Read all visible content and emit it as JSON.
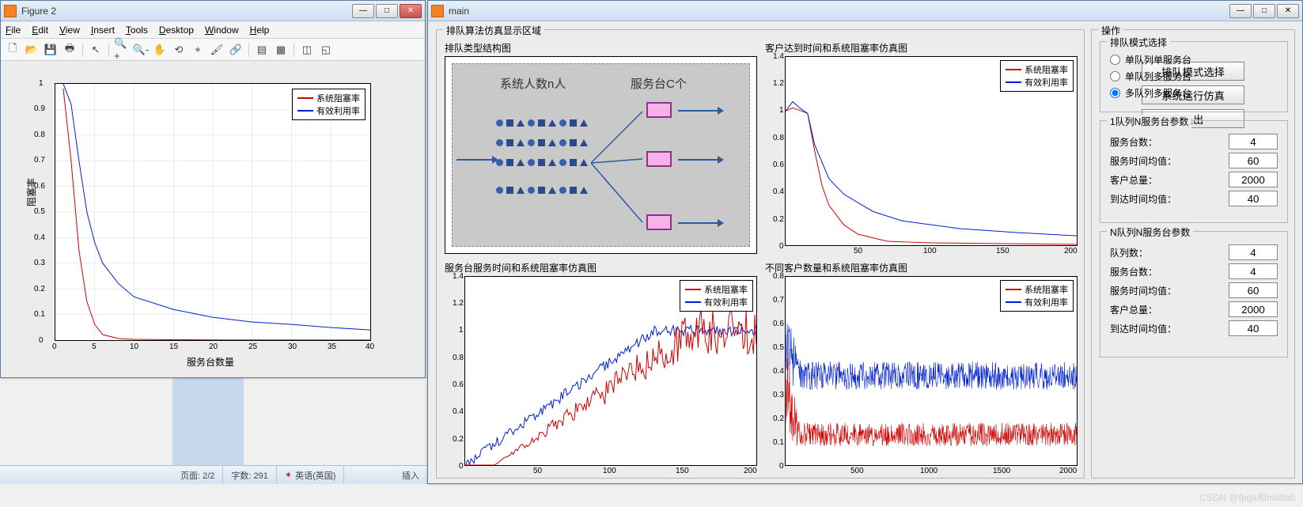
{
  "figure_window": {
    "title": "Figure 2",
    "menus": [
      "File",
      "Edit",
      "View",
      "Insert",
      "Tools",
      "Desktop",
      "Window",
      "Help"
    ],
    "toolbar_icons": [
      "new-file",
      "open",
      "save",
      "print",
      "pointer",
      "zoom-in",
      "zoom-out",
      "pan",
      "rotate",
      "data-cursor",
      "brush",
      "link",
      "colorbar",
      "legend",
      "sep",
      "dock",
      "undock"
    ]
  },
  "main_window": {
    "title": "main"
  },
  "status": {
    "page": "页面: 2/2",
    "chars": "字数: 291",
    "lang": "英语(英国)",
    "insert": "插入"
  },
  "watermark": "CSDN @fpga和matlab",
  "sim_area_title": "排队算法仿真显示区域",
  "ops_title": "操作",
  "panels": {
    "p1": {
      "title": "排队类型结构图",
      "text_people": "系统人数n人",
      "text_servers": "服务台C个"
    },
    "p2": {
      "title": "客户达到时间和系统阻塞率仿真图"
    },
    "p3": {
      "title": "服务台服务时间和系统阻塞率仿真图"
    },
    "p4": {
      "title": "不同客户数量和系统阻塞率仿真图"
    }
  },
  "legend": {
    "red": "系统阻塞率",
    "blue": "有效利用率"
  },
  "fig_chart": {
    "xlabel": "服务台数量",
    "ylabel": "阻塞率",
    "xticks": [
      "0",
      "5",
      "10",
      "15",
      "20",
      "25",
      "30",
      "35",
      "40"
    ],
    "yticks": [
      "0",
      "0.1",
      "0.2",
      "0.3",
      "0.4",
      "0.5",
      "0.6",
      "0.7",
      "0.8",
      "0.9",
      "1"
    ]
  },
  "chart_data": [
    {
      "type": "line",
      "title": "Figure 2",
      "xlabel": "服务台数量",
      "ylabel": "阻塞率",
      "xlim": [
        0,
        40
      ],
      "ylim": [
        0,
        1
      ],
      "series": [
        {
          "name": "系统阻塞率",
          "color": "#d00000",
          "x": [
            1,
            2,
            3,
            4,
            5,
            6,
            8,
            10,
            15,
            20,
            25,
            30,
            35,
            40
          ],
          "y": [
            0.98,
            0.7,
            0.35,
            0.15,
            0.06,
            0.02,
            0.005,
            0.002,
            0.001,
            0.0005,
            0.0003,
            0.0002,
            0.0001,
            0.0001
          ]
        },
        {
          "name": "有效利用率",
          "color": "#0020d0",
          "x": [
            1,
            2,
            3,
            4,
            5,
            6,
            8,
            10,
            15,
            20,
            25,
            30,
            35,
            40
          ],
          "y": [
            1.0,
            0.92,
            0.7,
            0.5,
            0.38,
            0.3,
            0.22,
            0.17,
            0.12,
            0.09,
            0.07,
            0.06,
            0.05,
            0.04
          ]
        }
      ]
    },
    {
      "type": "line",
      "title": "客户达到时间和系统阻塞率仿真图",
      "xlim": [
        0,
        200
      ],
      "ylim": [
        0,
        1.4
      ],
      "xticks": [
        0,
        50,
        100,
        150,
        200
      ],
      "yticks": [
        0,
        0.2,
        0.4,
        0.6,
        0.8,
        1.0,
        1.2,
        1.4
      ],
      "series": [
        {
          "name": "系统阻塞率",
          "color": "#d00000",
          "x": [
            0,
            5,
            10,
            15,
            20,
            25,
            30,
            40,
            50,
            70,
            100,
            150,
            200
          ],
          "y": [
            1.0,
            1.02,
            0.98,
            0.9,
            0.7,
            0.45,
            0.3,
            0.15,
            0.08,
            0.03,
            0.015,
            0.008,
            0.005
          ]
        },
        {
          "name": "有效利用率",
          "color": "#0020d0",
          "x": [
            0,
            5,
            10,
            15,
            20,
            30,
            40,
            60,
            80,
            120,
            160,
            200
          ],
          "y": [
            1.0,
            1.07,
            1.02,
            0.9,
            0.75,
            0.5,
            0.38,
            0.25,
            0.18,
            0.12,
            0.09,
            0.07
          ]
        }
      ]
    },
    {
      "type": "line",
      "title": "服务台服务时间和系统阻塞率仿真图",
      "xlim": [
        0,
        200
      ],
      "ylim": [
        0,
        1.4
      ],
      "xticks": [
        0,
        50,
        100,
        150,
        200
      ],
      "yticks": [
        0,
        0.2,
        0.4,
        0.6,
        0.8,
        1.0,
        1.2,
        1.4
      ],
      "series": [
        {
          "name": "系统阻塞率",
          "color": "#d00000",
          "x": [
            0,
            20,
            40,
            60,
            80,
            100,
            120,
            140,
            160,
            180,
            200
          ],
          "y": [
            0.0,
            0.05,
            0.12,
            0.25,
            0.45,
            0.7,
            0.88,
            0.95,
            0.97,
            0.98,
            0.99
          ]
        },
        {
          "name": "有效利用率",
          "color": "#0020d0",
          "x": [
            0,
            20,
            40,
            60,
            80,
            100,
            120,
            140,
            160,
            180,
            200
          ],
          "y": [
            0.02,
            0.18,
            0.35,
            0.52,
            0.7,
            0.85,
            0.95,
            0.99,
            1.0,
            1.0,
            1.0
          ]
        }
      ]
    },
    {
      "type": "line",
      "title": "不同客户数量和系统阻塞率仿真图",
      "xlim": [
        0,
        2000
      ],
      "ylim": [
        0,
        0.8
      ],
      "xticks": [
        0,
        500,
        1000,
        1500,
        2000
      ],
      "yticks": [
        0,
        0.1,
        0.2,
        0.3,
        0.4,
        0.5,
        0.6,
        0.7,
        0.8
      ],
      "series": [
        {
          "name": "系统阻塞率",
          "color": "#d00000",
          "note": "noisy around mean≈0.08, spikes up to 0.5 near x<100"
        },
        {
          "name": "有效利用率",
          "color": "#0020d0",
          "note": "noisy around mean≈0.38, spikes up to 0.75 near x<100"
        }
      ]
    }
  ],
  "controls": {
    "mode_group": "排队模式选择",
    "modes": [
      "单队列单服务台",
      "单队列多服务台",
      "多队列多服务台"
    ],
    "mode_selected": 2,
    "group1": {
      "title": "1队列N服务台参数",
      "servers_label": "服务台数：",
      "servers_value": "4",
      "svc_time_label": "服务时间均值：",
      "svc_time_value": "60",
      "cust_label": "客户总量：",
      "cust_value": "2000",
      "arr_time_label": "到达时间均值：",
      "arr_time_value": "40"
    },
    "group2": {
      "title": "N队列N服务台参数",
      "queues_label": "队列数：",
      "queues_value": "4",
      "servers_label": "服务台数：",
      "servers_value": "4",
      "svc_time_label": "服务时间均值：",
      "svc_time_value": "60",
      "cust_label": "客户总量：",
      "cust_value": "2000",
      "arr_time_label": "到达时间均值：",
      "arr_time_value": "40"
    },
    "btn_mode": "排队模式选择",
    "btn_run": "系统运行仿真",
    "btn_exit": "退出"
  }
}
